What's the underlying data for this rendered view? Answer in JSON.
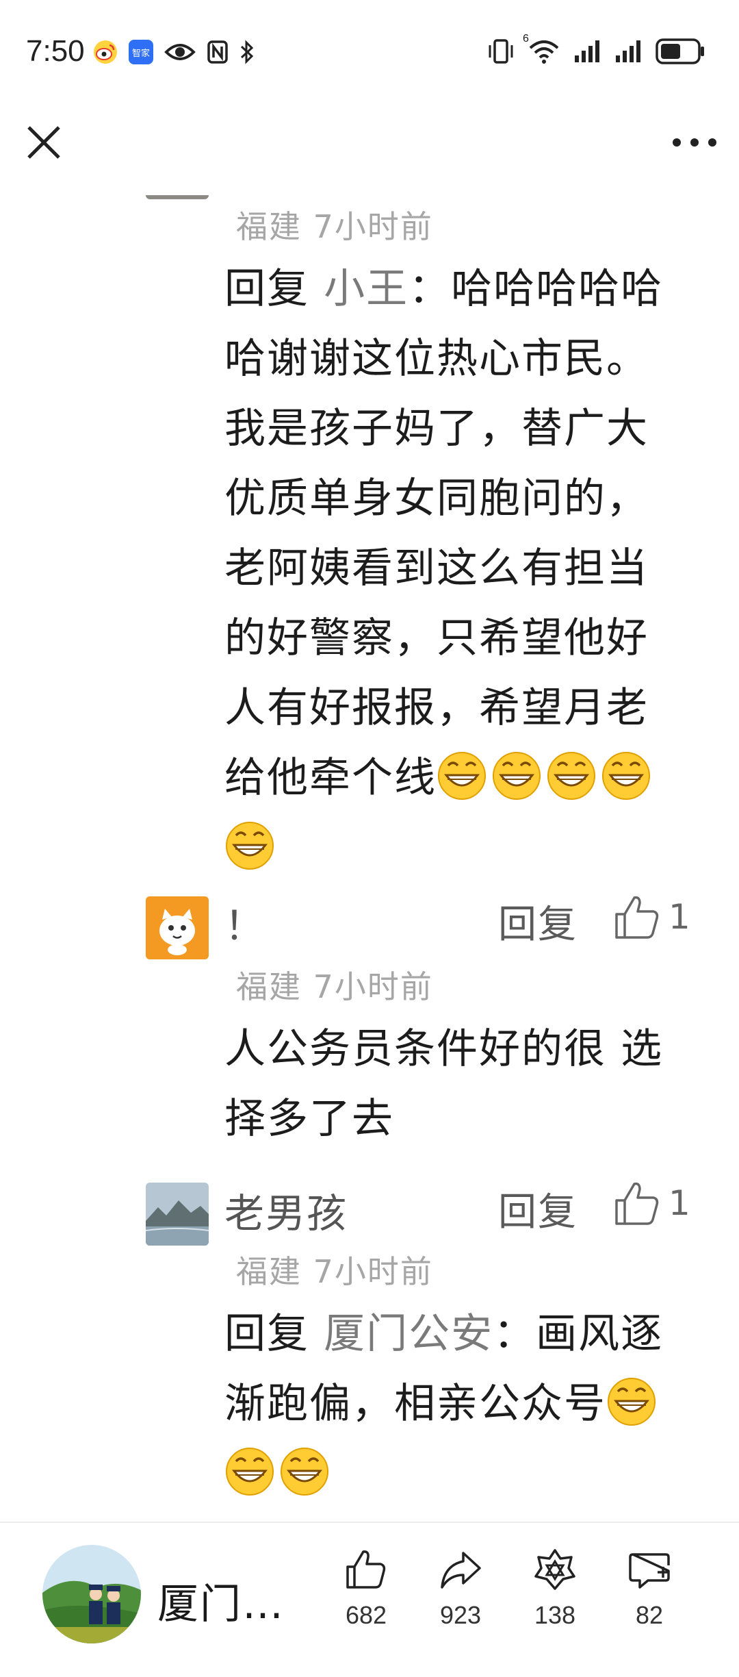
{
  "status_bar": {
    "time": "7:50",
    "left_icons": [
      "weibo-icon",
      "zhijia-app-icon",
      "eye-icon",
      "nfc-icon",
      "bluetooth-icon"
    ],
    "zhijia_label": "智家",
    "right_icons": [
      "vibrate-icon",
      "wifi-6-icon",
      "signal-icon",
      "signal-icon",
      "battery-icon"
    ],
    "wifi_badge": "6"
  },
  "topbar": {
    "close_icon": "close-icon",
    "more_icon": "more-icon"
  },
  "comments": [
    {
      "meta": "福建  7小时前",
      "reply_prefix": " 回复 ",
      "reply_to": "小王",
      "reply_colon": "：",
      "text": "哈哈哈哈哈哈谢谢这位热心市民。我是孩子妈了，替广大优质单身女同胞问的，老阿姨看到这么有担当的好警察，只希望他好人有好报报，希望月老给他牵个线",
      "emoji_count": 5
    },
    {
      "username": "！",
      "reply_label": "回复",
      "likes": "1",
      "meta": "福建  7小时前",
      "text": "人公务员条件好的很 选择多了去"
    },
    {
      "username": "老男孩",
      "reply_label": "回复",
      "likes": "1",
      "meta": "福建  7小时前",
      "reply_prefix": " 回复 ",
      "reply_to": "厦门公安",
      "reply_colon": "：",
      "text": "画风逐渐跑偏，相亲公众号",
      "emoji_count": 3
    }
  ],
  "bottom_bar": {
    "account_name": "厦门…",
    "actions": [
      {
        "icon": "thumbs-up-icon",
        "count": "682"
      },
      {
        "icon": "share-icon",
        "count": "923"
      },
      {
        "icon": "recommend-icon",
        "count": "138"
      },
      {
        "icon": "comment-add-icon",
        "count": "82"
      }
    ]
  }
}
